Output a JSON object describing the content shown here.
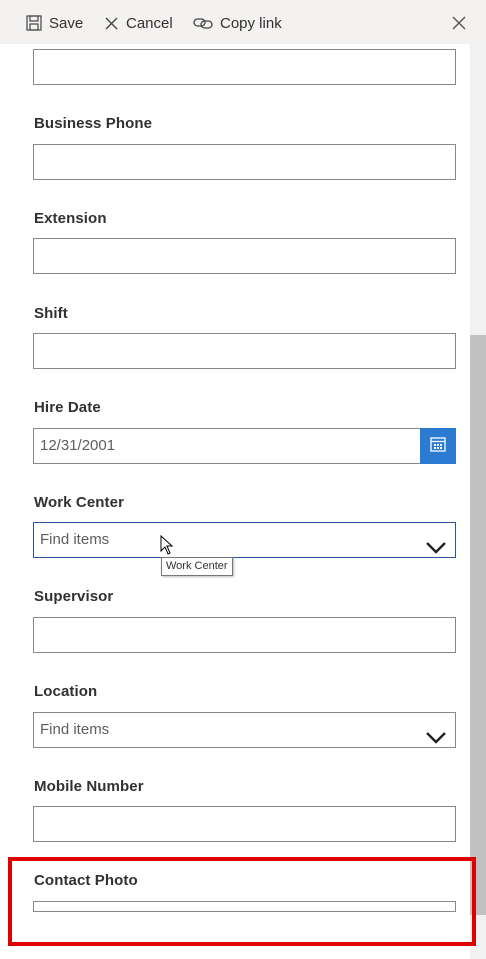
{
  "toolbar": {
    "save_label": "Save",
    "cancel_label": "Cancel",
    "copy_link_label": "Copy link"
  },
  "fields": {
    "business_phone": {
      "label": "Business Phone",
      "value": ""
    },
    "extension": {
      "label": "Extension",
      "value": ""
    },
    "shift": {
      "label": "Shift",
      "value": ""
    },
    "hire_date": {
      "label": "Hire Date",
      "value": "12/31/2001"
    },
    "work_center": {
      "label": "Work Center",
      "placeholder": "Find items",
      "tooltip": "Work Center"
    },
    "supervisor": {
      "label": "Supervisor",
      "value": ""
    },
    "location": {
      "label": "Location",
      "placeholder": "Find items"
    },
    "mobile_number": {
      "label": "Mobile Number",
      "value": ""
    },
    "contact_photo": {
      "label": "Contact Photo"
    }
  },
  "colors": {
    "accent": "#2b7bd3",
    "highlight": "#e00000",
    "toolbar_bg": "#f3f2f1"
  },
  "icons": [
    "save-icon",
    "cancel-icon",
    "link-icon",
    "close-icon",
    "calendar-icon",
    "chevron-down-icon",
    "mouse-cursor-icon"
  ]
}
